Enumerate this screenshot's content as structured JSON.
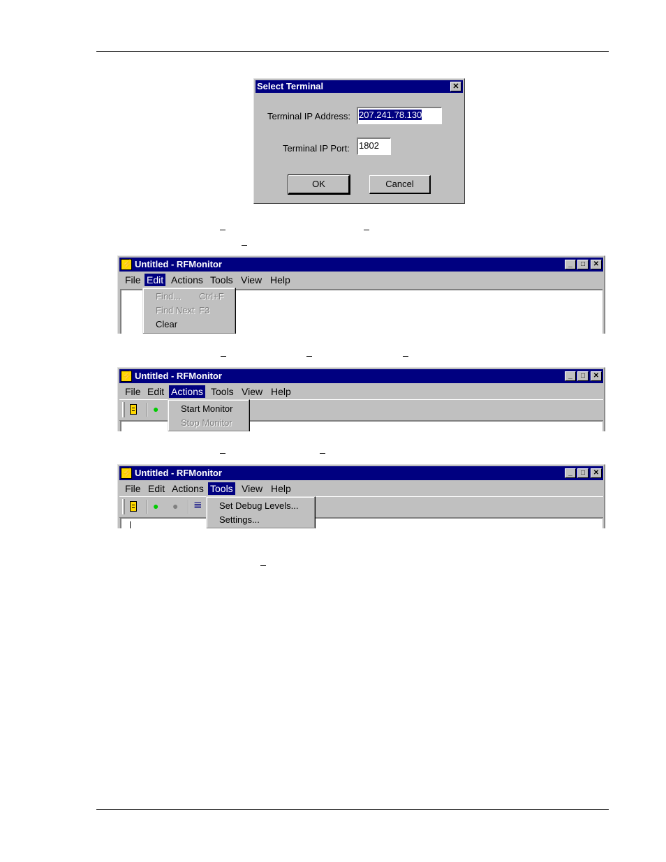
{
  "select_terminal_dialog": {
    "title": "Select Terminal",
    "close_glyph": "✕",
    "ip_address_label": "Terminal IP Address:",
    "ip_address_value": "207.241.78.130",
    "ip_port_label": "Terminal IP Port:",
    "ip_port_value": "1802",
    "ok_label": "OK",
    "cancel_label": "Cancel"
  },
  "windows": [
    {
      "title": "Untitled - RFMonitor",
      "menu": [
        "File",
        "Edit",
        "Actions",
        "Tools",
        "View",
        "Help"
      ],
      "open_menu": "Edit",
      "dropdown": [
        {
          "label": "Find...",
          "shortcut": "Ctrl+F",
          "enabled": false
        },
        {
          "label": "Find Next",
          "shortcut": "F3",
          "enabled": false
        },
        {
          "label": "Clear",
          "shortcut": "",
          "enabled": true
        }
      ]
    },
    {
      "title": "Untitled - RFMonitor",
      "menu": [
        "File",
        "Edit",
        "Actions",
        "Tools",
        "View",
        "Help"
      ],
      "open_menu": "Actions",
      "dropdown": [
        {
          "label": "Start Monitor",
          "enabled": true
        },
        {
          "label": "Stop Monitor",
          "enabled": false
        }
      ]
    },
    {
      "title": "Untitled - RFMonitor",
      "menu": [
        "File",
        "Edit",
        "Actions",
        "Tools",
        "View",
        "Help"
      ],
      "open_menu": "Tools",
      "dropdown": [
        {
          "label": "Set Debug Levels...",
          "enabled": true
        },
        {
          "label": "Settings...",
          "enabled": true
        }
      ]
    }
  ],
  "window_controls": {
    "minimize": "_",
    "maximize": "□",
    "close": "✕"
  },
  "colors": {
    "titlebar": "#000080",
    "face": "#c0c0c0",
    "status_on": "#00cc00",
    "status_off": "#808080"
  },
  "icons": [
    "lightning-app-icon",
    "document-icon",
    "green-dot-icon",
    "gray-dot-icon",
    "filter-icon"
  ]
}
